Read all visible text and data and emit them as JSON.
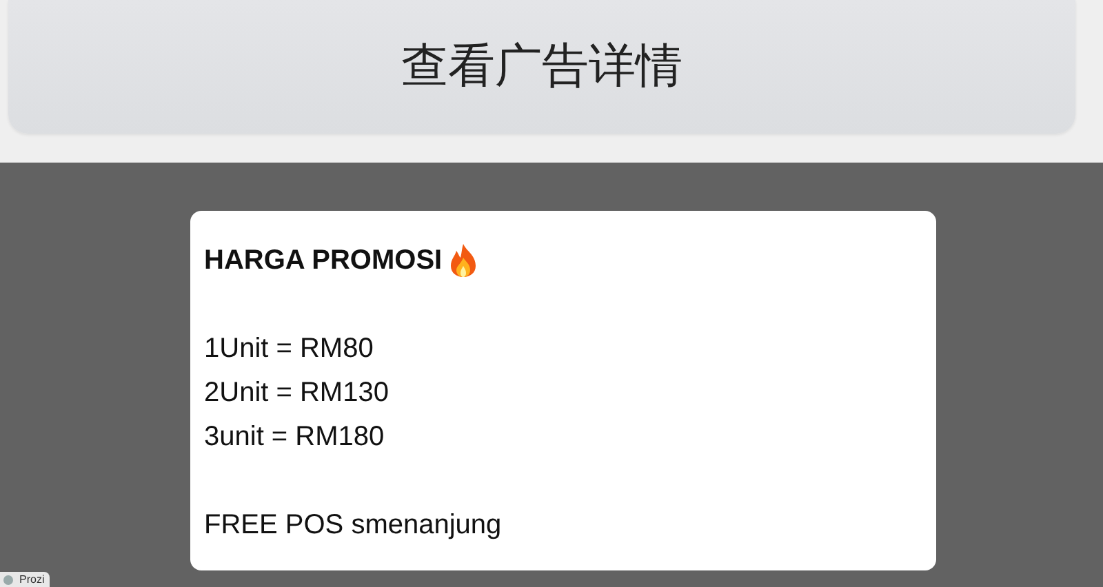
{
  "button": {
    "label": "查看广告详情"
  },
  "card": {
    "title": "HARGA PROMOSI",
    "paragraphs": [
      [
        "1Unit = RM80",
        "2Unit = RM130",
        "3unit = RM180"
      ],
      [
        "FREE POS smenanjung"
      ]
    ]
  },
  "corner_tab": {
    "label": "Prozi"
  }
}
